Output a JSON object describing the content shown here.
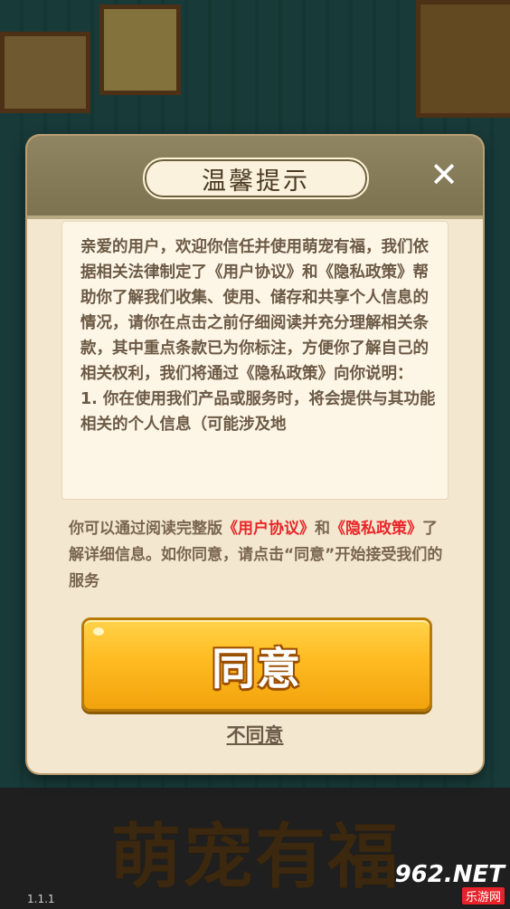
{
  "background": {
    "logo_text": "萌宠有福",
    "version": "1.1.1"
  },
  "watermark": {
    "main": "962.NET",
    "sub": "乐游网"
  },
  "dialog": {
    "title": "温馨提示",
    "close_icon": "close-icon",
    "content": "亲爱的用户，欢迎你信任并使用萌宠有福，我们依据相关法律制定了《用户协议》和《隐私政策》帮助你了解我们收集、使用、储存和共享个人信息的情况，请你在点击之前仔细阅读并充分理解相关条款，其中重点条款已为你标注，方便你了解自己的相关权利，我们将通过《隐私政策》向你说明：\n1. 你在使用我们产品或服务时，将会提供与其功能相关的个人信息（可能涉及地",
    "notice_prefix": "你可以通过阅读完整版",
    "notice_link1": "《用户协议》",
    "notice_and": "和",
    "notice_link2": "《隐私政策》",
    "notice_suffix": "了解详细信息。如你同意，请点击“同意”开始接受我们的服务",
    "agree_label": "同意",
    "disagree_label": "不同意"
  },
  "colors": {
    "accent_button": "#ffbb21",
    "link_red": "#e8262a",
    "header_bg": "#7c7250"
  }
}
